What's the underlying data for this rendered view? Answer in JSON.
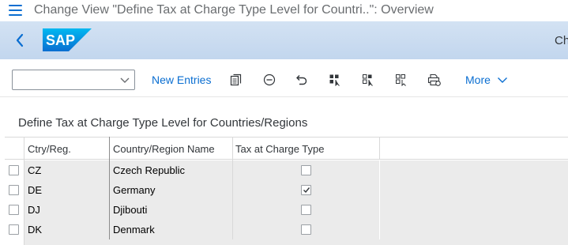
{
  "titlebar": {
    "menu_icon": "hamburger-menu-icon",
    "title": "Change View \"Define Tax at Charge Type Level for Countri..\": Overview"
  },
  "shellbar": {
    "back_icon": "chevron-left-icon",
    "logo_text": "SAP",
    "right_text": "Ch",
    "colors": {
      "background": "#c8daf0",
      "logo_blue": "#0a6ed1"
    }
  },
  "toolbar": {
    "select_value": "",
    "new_entries_label": "New Entries",
    "icons": [
      "copy-icon",
      "delete-icon",
      "undo-icon",
      "select-all-icon",
      "select-block-icon",
      "deselect-all-icon",
      "print-icon"
    ],
    "more_label": "More"
  },
  "section": {
    "title": "Define Tax at Charge Type Level for Countries/Regions"
  },
  "table": {
    "columns": [
      "Ctry/Reg.",
      "Country/Region Name",
      "Tax at Charge Type"
    ],
    "rows": [
      {
        "code": "CZ",
        "name": "Czech Republic",
        "tax_at_charge_type": false
      },
      {
        "code": "DE",
        "name": "Germany",
        "tax_at_charge_type": true
      },
      {
        "code": "DJ",
        "name": "Djibouti",
        "tax_at_charge_type": false
      },
      {
        "code": "DK",
        "name": "Denmark",
        "tax_at_charge_type": false
      }
    ]
  }
}
